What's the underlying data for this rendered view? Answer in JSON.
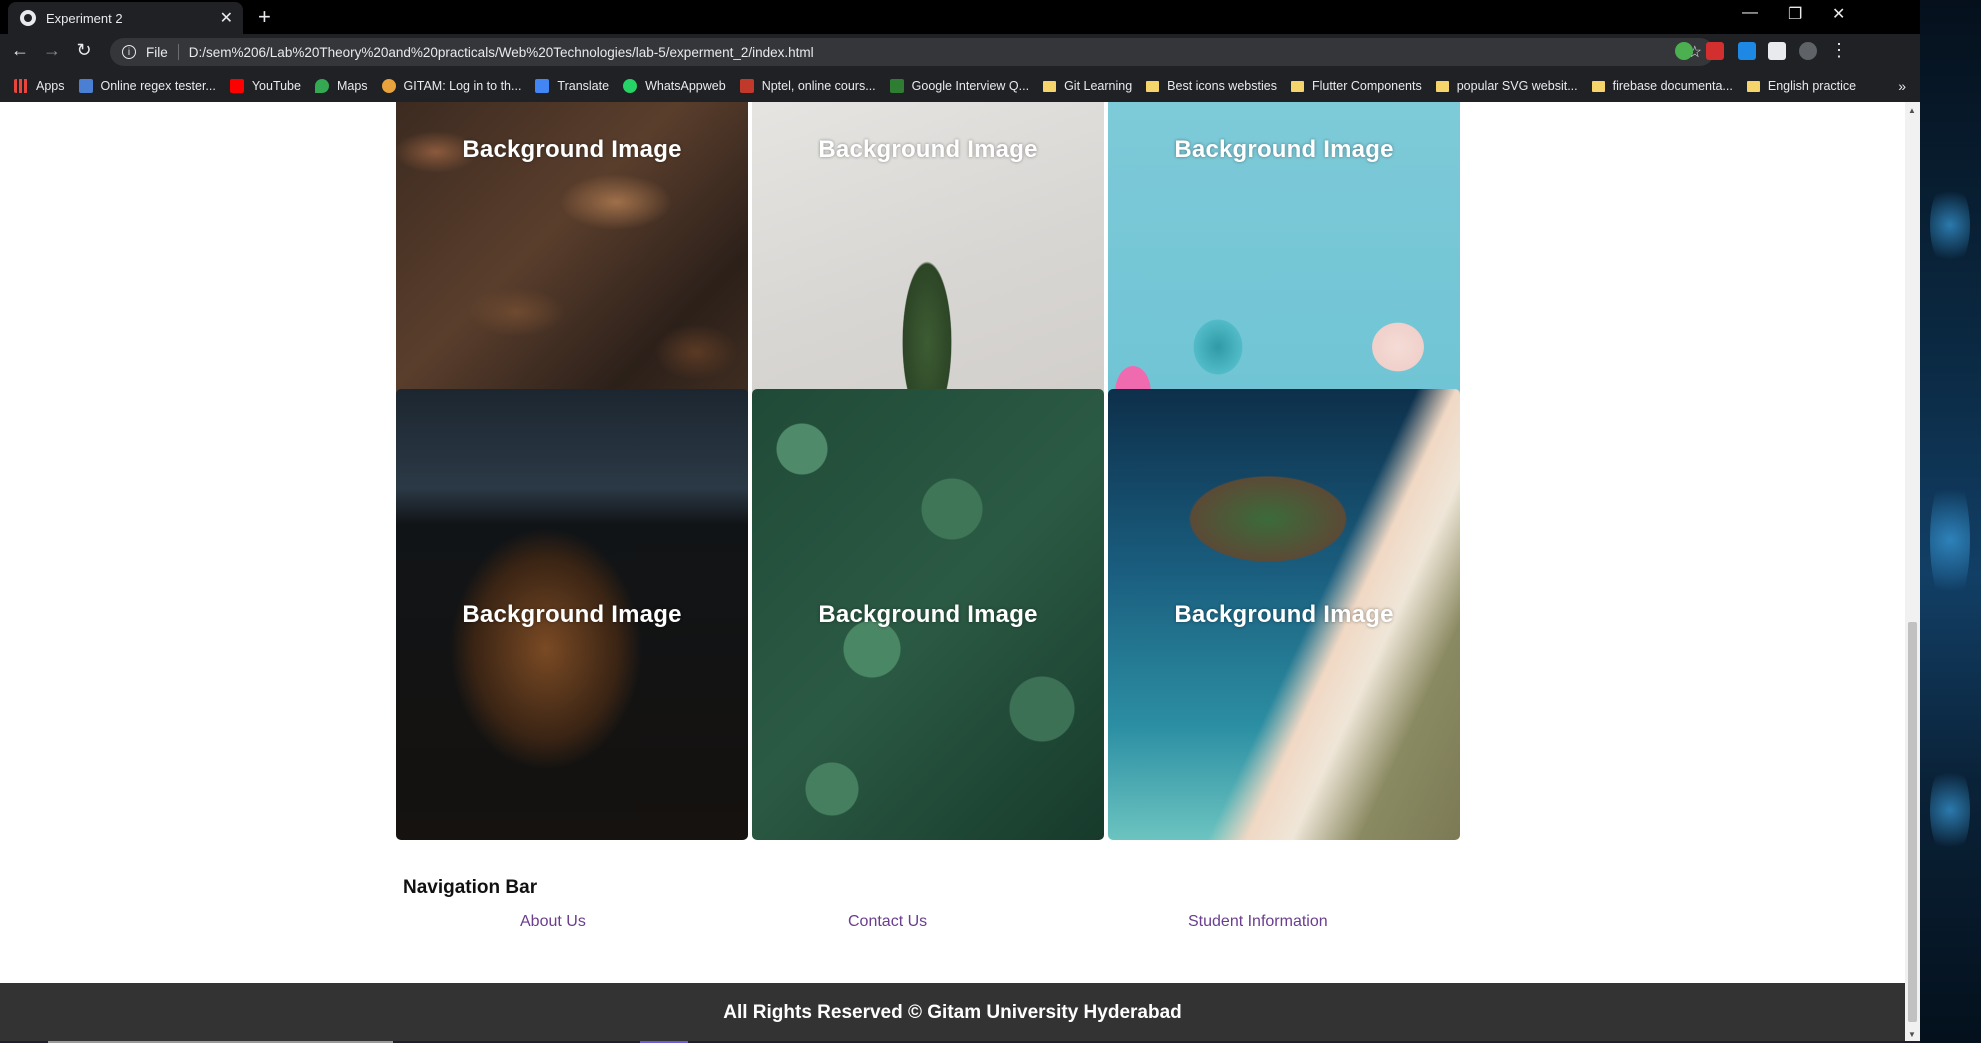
{
  "browser": {
    "tab_title": "Experiment 2",
    "new_tab": "+",
    "url_scheme": "File",
    "url": "D:/sem%206/Lab%20Theory%20and%20practicals/Web%20Technologies/lab-5/experment_2/index.html",
    "bookmarks": [
      {
        "label": "Apps",
        "icon": "apps-grid-icon",
        "color": "#e8453c"
      },
      {
        "label": "Online regex tester...",
        "icon": "regex-icon",
        "color": "#4a7fd4"
      },
      {
        "label": "YouTube",
        "icon": "youtube-icon",
        "color": "#ff0000"
      },
      {
        "label": "Maps",
        "icon": "maps-pin-icon",
        "color": "#34a853"
      },
      {
        "label": "GITAM: Log in to th...",
        "icon": "gitam-icon",
        "color": "#e8a33c"
      },
      {
        "label": "Translate",
        "icon": "translate-icon",
        "color": "#4285f4"
      },
      {
        "label": "WhatsAppweb",
        "icon": "whatsapp-icon",
        "color": "#25d366"
      },
      {
        "label": "Nptel, online cours...",
        "icon": "nptel-icon",
        "color": "#c0392b"
      },
      {
        "label": "Google Interview Q...",
        "icon": "interview-icon",
        "color": "#2e7d32"
      },
      {
        "label": "Git Learning",
        "icon": "folder-icon"
      },
      {
        "label": "Best icons websties",
        "icon": "folder-icon"
      },
      {
        "label": "Flutter Components",
        "icon": "folder-icon"
      },
      {
        "label": "popular SVG websit...",
        "icon": "folder-icon"
      },
      {
        "label": "firebase documenta...",
        "icon": "folder-icon"
      },
      {
        "label": "English practice",
        "icon": "folder-icon"
      }
    ],
    "more": "»"
  },
  "gallery": {
    "caption": "Background Image",
    "images": [
      "dry-leaves",
      "green-leaf-on-marble",
      "vase-and-cup",
      "japanese-shop",
      "green-plants",
      "aerial-beach"
    ]
  },
  "navigation": {
    "title": "Navigation Bar",
    "links": [
      "About Us",
      "Contact Us",
      "Student Information"
    ]
  },
  "footer": {
    "text": "All Rights Reserved © Gitam University Hyderabad"
  }
}
